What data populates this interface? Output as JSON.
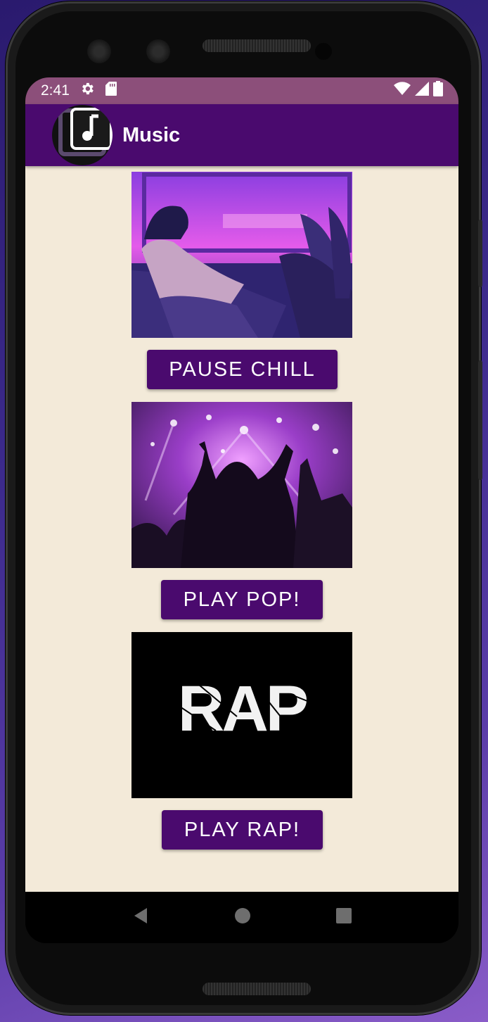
{
  "status_bar": {
    "time": "2:41",
    "icons": [
      "settings-icon",
      "sd-card-icon",
      "wifi-icon",
      "signal-icon",
      "battery-icon"
    ]
  },
  "app_bar": {
    "title": "Music",
    "logo_icon": "music-note-icon"
  },
  "tracks": [
    {
      "image": "chill-illustration",
      "button_label": "PAUSE CHILL"
    },
    {
      "image": "pop-concert-crowd",
      "button_label": "PLAY POP!"
    },
    {
      "image": "rap-logo",
      "image_text": "RAP",
      "button_label": "PLAY RAP!"
    }
  ],
  "nav_bar": {
    "icons": [
      "back-icon",
      "home-icon",
      "recents-icon"
    ]
  },
  "colors": {
    "primary": "#4a0a6e",
    "status_bar": "#8c4f7a",
    "background": "#f3ead9",
    "on_primary": "#ffffff"
  }
}
